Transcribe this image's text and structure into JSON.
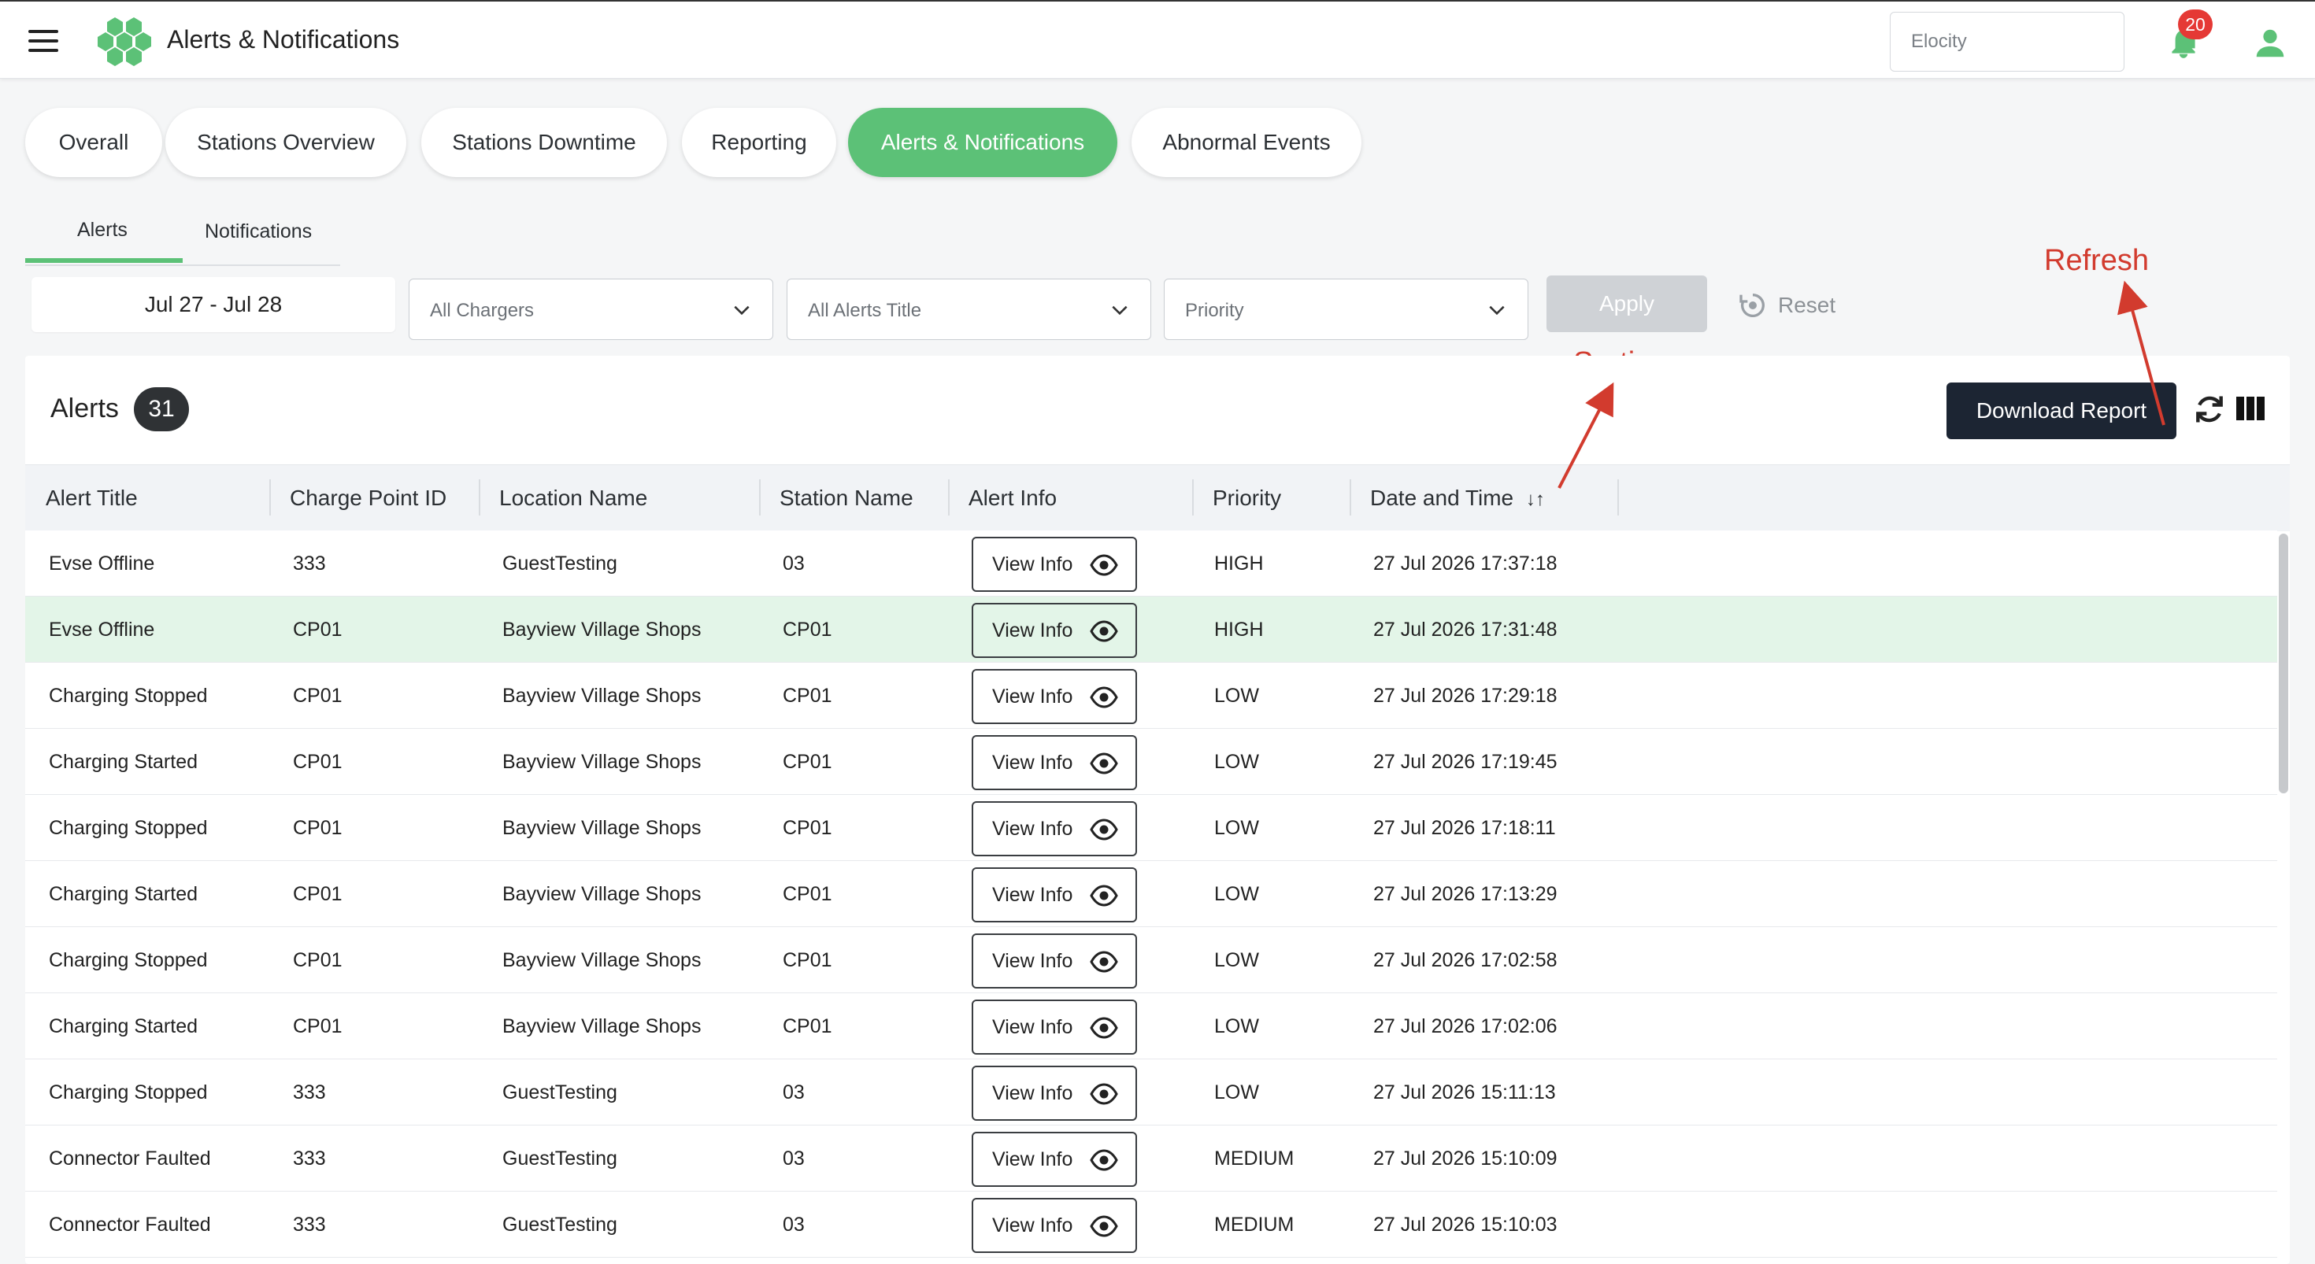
{
  "header": {
    "title": "Alerts & Notifications",
    "org_select": "Elocity",
    "notification_count": "20"
  },
  "main_tabs": [
    {
      "label": "Overall"
    },
    {
      "label": "Stations Overview"
    },
    {
      "label": "Stations Downtime"
    },
    {
      "label": "Reporting"
    },
    {
      "label": "Alerts & Notifications",
      "active": true
    },
    {
      "label": "Abnormal Events"
    }
  ],
  "sub_tabs": [
    {
      "label": "Alerts",
      "active": true
    },
    {
      "label": "Notifications"
    }
  ],
  "filters": {
    "date_range": "Jul 27 - Jul 28",
    "chargers": "All Chargers",
    "alerts_title": "All Alerts Title",
    "priority": "Priority",
    "apply_label": "Apply",
    "reset_label": "Reset"
  },
  "annotations": {
    "refresh": "Refresh",
    "sorting": "Sorting"
  },
  "panel": {
    "title": "Alerts",
    "count": "31",
    "download_label": "Download Report"
  },
  "table": {
    "columns": [
      "Alert Title",
      "Charge Point ID",
      "Location Name",
      "Station Name",
      "Alert Info",
      "Priority",
      "Date and Time"
    ],
    "sort_glyph": "↓↑",
    "view_label": "View Info",
    "rows": [
      {
        "title": "Evse Offline",
        "cpid": "333",
        "location": "GuestTesting",
        "station": "03",
        "priority": "HIGH",
        "datetime": "27 Jul 2026 17:37:18"
      },
      {
        "title": "Evse Offline",
        "cpid": "CP01",
        "location": "Bayview Village Shops",
        "station": "CP01",
        "priority": "HIGH",
        "datetime": "27 Jul 2026 17:31:48",
        "highlighted": true
      },
      {
        "title": "Charging Stopped",
        "cpid": "CP01",
        "location": "Bayview Village Shops",
        "station": "CP01",
        "priority": "LOW",
        "datetime": "27 Jul 2026 17:29:18"
      },
      {
        "title": "Charging Started",
        "cpid": "CP01",
        "location": "Bayview Village Shops",
        "station": "CP01",
        "priority": "LOW",
        "datetime": "27 Jul 2026 17:19:45"
      },
      {
        "title": "Charging Stopped",
        "cpid": "CP01",
        "location": "Bayview Village Shops",
        "station": "CP01",
        "priority": "LOW",
        "datetime": "27 Jul 2026 17:18:11"
      },
      {
        "title": "Charging Started",
        "cpid": "CP01",
        "location": "Bayview Village Shops",
        "station": "CP01",
        "priority": "LOW",
        "datetime": "27 Jul 2026 17:13:29"
      },
      {
        "title": "Charging Stopped",
        "cpid": "CP01",
        "location": "Bayview Village Shops",
        "station": "CP01",
        "priority": "LOW",
        "datetime": "27 Jul 2026 17:02:58"
      },
      {
        "title": "Charging Started",
        "cpid": "CP01",
        "location": "Bayview Village Shops",
        "station": "CP01",
        "priority": "LOW",
        "datetime": "27 Jul 2026 17:02:06"
      },
      {
        "title": "Charging Stopped",
        "cpid": "333",
        "location": "GuestTesting",
        "station": "03",
        "priority": "LOW",
        "datetime": "27 Jul 2026 15:11:13"
      },
      {
        "title": "Connector Faulted",
        "cpid": "333",
        "location": "GuestTesting",
        "station": "03",
        "priority": "MEDIUM",
        "datetime": "27 Jul 2026 15:10:09"
      },
      {
        "title": "Connector Faulted",
        "cpid": "333",
        "location": "GuestTesting",
        "station": "03",
        "priority": "MEDIUM",
        "datetime": "27 Jul 2026 15:10:03"
      }
    ]
  },
  "colors": {
    "accent": "#5cc177",
    "download_bg": "#1c2533",
    "badge": "#e53935",
    "annotation": "#d23b2e",
    "highlight_row": "#e3f5e8"
  }
}
